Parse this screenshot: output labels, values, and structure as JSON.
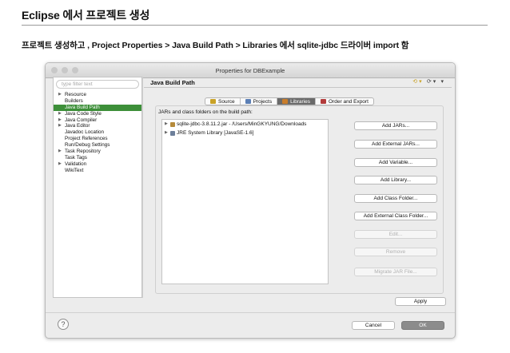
{
  "slide": {
    "title": "Eclipse 에서 프로젝트 생성",
    "subtitle": "프로젝트 생성하고 , Project Properties > Java Build Path > Libraries 에서  sqlite-jdbc  드라이버  import 함"
  },
  "window": {
    "title": "Properties for DBExample",
    "traffic_colors": [
      "#c8c8c8",
      "#c8c8c8",
      "#c8c8c8"
    ]
  },
  "left": {
    "filter_placeholder": "type filter text",
    "items": [
      {
        "label": "Resource",
        "expandable": true
      },
      {
        "label": "Builders",
        "expandable": false
      },
      {
        "label": "Java Build Path",
        "expandable": false,
        "selected": true
      },
      {
        "label": "Java Code Style",
        "expandable": true
      },
      {
        "label": "Java Compiler",
        "expandable": true
      },
      {
        "label": "Java Editor",
        "expandable": true
      },
      {
        "label": "Javadoc Location",
        "expandable": false
      },
      {
        "label": "Project References",
        "expandable": false
      },
      {
        "label": "Run/Debug Settings",
        "expandable": false
      },
      {
        "label": "Task Repository",
        "expandable": true
      },
      {
        "label": "Task Tags",
        "expandable": false
      },
      {
        "label": "Validation",
        "expandable": true
      },
      {
        "label": "WikiText",
        "expandable": false
      }
    ]
  },
  "right": {
    "title": "Java Build Path",
    "tabs": [
      {
        "label": "Source",
        "active": false,
        "icon_color": "#c9a227"
      },
      {
        "label": "Projects",
        "active": false,
        "icon_color": "#5b7fb5"
      },
      {
        "label": "Libraries",
        "active": true,
        "icon_color": "#c97d2a"
      },
      {
        "label": "Order and Export",
        "active": false,
        "icon_color": "#b23a3a"
      }
    ],
    "group_label": "JARs and class folders on the build path:",
    "libraries": [
      {
        "label": "sqlite-jdbc-3.8.11.2.jar - /Users/MinGKYUNG/Downloads",
        "icon_color": "#b58a3a"
      },
      {
        "label": "JRE System Library [JavaSE-1.6]",
        "icon_color": "#6d7f9a"
      }
    ],
    "buttons": [
      {
        "label": "Add JARs...",
        "enabled": true
      },
      {
        "label": "Add External JARs...",
        "enabled": true
      },
      {
        "label": "Add Variable...",
        "enabled": true
      },
      {
        "label": "Add Library...",
        "enabled": true
      },
      {
        "label": "Add Class Folder...",
        "enabled": true
      },
      {
        "label": "Add External Class Folder...",
        "enabled": true
      },
      {
        "label": "Edit...",
        "enabled": false
      },
      {
        "label": "Remove",
        "enabled": false
      },
      {
        "label": "Migrate JAR File...",
        "enabled": false
      }
    ],
    "apply_label": "Apply"
  },
  "footer": {
    "help_label": "?",
    "cancel_label": "Cancel",
    "ok_label": "OK"
  }
}
